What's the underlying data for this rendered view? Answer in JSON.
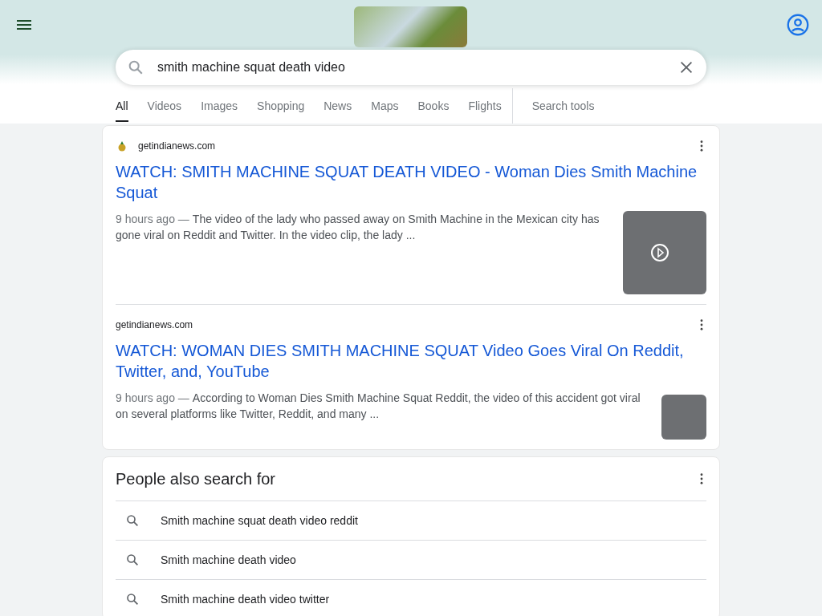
{
  "search": {
    "value": "smith machine squat death video"
  },
  "tabs": [
    {
      "label": "All",
      "selected": true
    },
    {
      "label": "Videos",
      "selected": false
    },
    {
      "label": "Images",
      "selected": false
    },
    {
      "label": "Shopping",
      "selected": false
    },
    {
      "label": "News",
      "selected": false
    },
    {
      "label": "Maps",
      "selected": false
    },
    {
      "label": "Books",
      "selected": false
    },
    {
      "label": "Flights",
      "selected": false
    }
  ],
  "search_tools": "Search tools",
  "results": [
    {
      "site": "getindianews.com",
      "favicon": true,
      "title": "WATCH: SMITH MACHINE SQUAT DEATH VIDEO - Woman Dies Smith Machine Squat",
      "date": "9 hours ago —",
      "snippet": "The video of the lady who passed away on Smith Machine in the Mexican city has gone viral on Reddit and Twitter. In the video clip, the lady ...",
      "kind": "large"
    },
    {
      "site": "getindianews.com",
      "favicon": false,
      "title": "WATCH: WOMAN DIES SMITH MACHINE SQUAT Video Goes Viral On Reddit, Twitter, and, YouTube",
      "date": "9 hours ago —",
      "snippet": "According to Woman Dies Smith Machine Squat Reddit, the video of this accident got viral on several platforms like Twitter, Reddit, and many ...",
      "kind": "small"
    }
  ],
  "related": {
    "title": "People also search for",
    "items": [
      "Smith machine squat death video reddit",
      "Smith machine death video",
      "Smith machine death video twitter"
    ]
  }
}
